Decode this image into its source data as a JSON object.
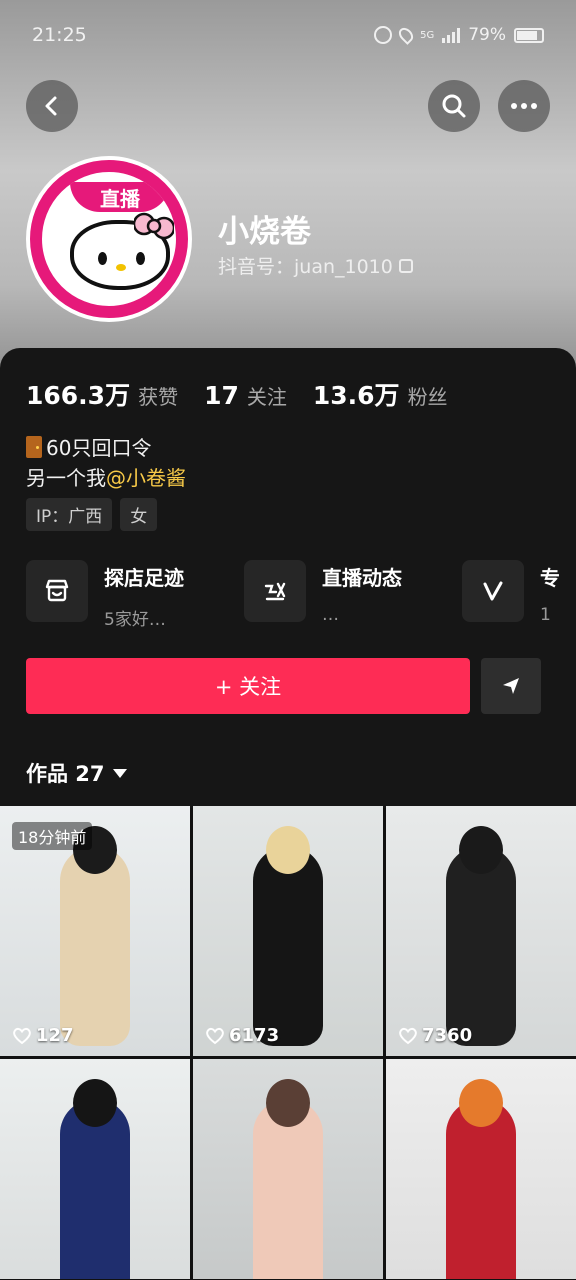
{
  "status_bar": {
    "time": "21:25",
    "network": "5G",
    "battery": "79%"
  },
  "profile": {
    "live_label": "直播",
    "name": "小烧卷",
    "douyin_id": "抖音号：juan_1010"
  },
  "stats": [
    {
      "value": "166.3万",
      "label": "获赞"
    },
    {
      "value": "17",
      "label": "关注"
    },
    {
      "value": "13.6万",
      "label": "粉丝"
    }
  ],
  "bio": {
    "line1": "60只回口令",
    "line2_prefix": "另一个我",
    "line2_mention": "@小卷酱"
  },
  "tags": [
    "IP：广西",
    "女"
  ],
  "cards": [
    {
      "title": "探店足迹",
      "subtitle": "5家好…",
      "icon": "shop-icon"
    },
    {
      "title": "直播动态",
      "subtitle": "…",
      "icon": "live-dynamic-icon"
    },
    {
      "title": "专",
      "subtitle": "1",
      "icon": "music-v-icon"
    }
  ],
  "follow_button": "+ 关注",
  "works_tab": "作品 27",
  "videos": [
    {
      "likes": "127",
      "badge": "18分钟前"
    },
    {
      "likes": "6173",
      "badge": ""
    },
    {
      "likes": "7360",
      "badge": ""
    },
    {
      "likes": "",
      "badge": ""
    },
    {
      "likes": "",
      "badge": ""
    },
    {
      "likes": "",
      "badge": ""
    }
  ],
  "colors": {
    "follow": "#fe2c55",
    "mention": "#f7c948",
    "live_ring": "#e6197a"
  }
}
